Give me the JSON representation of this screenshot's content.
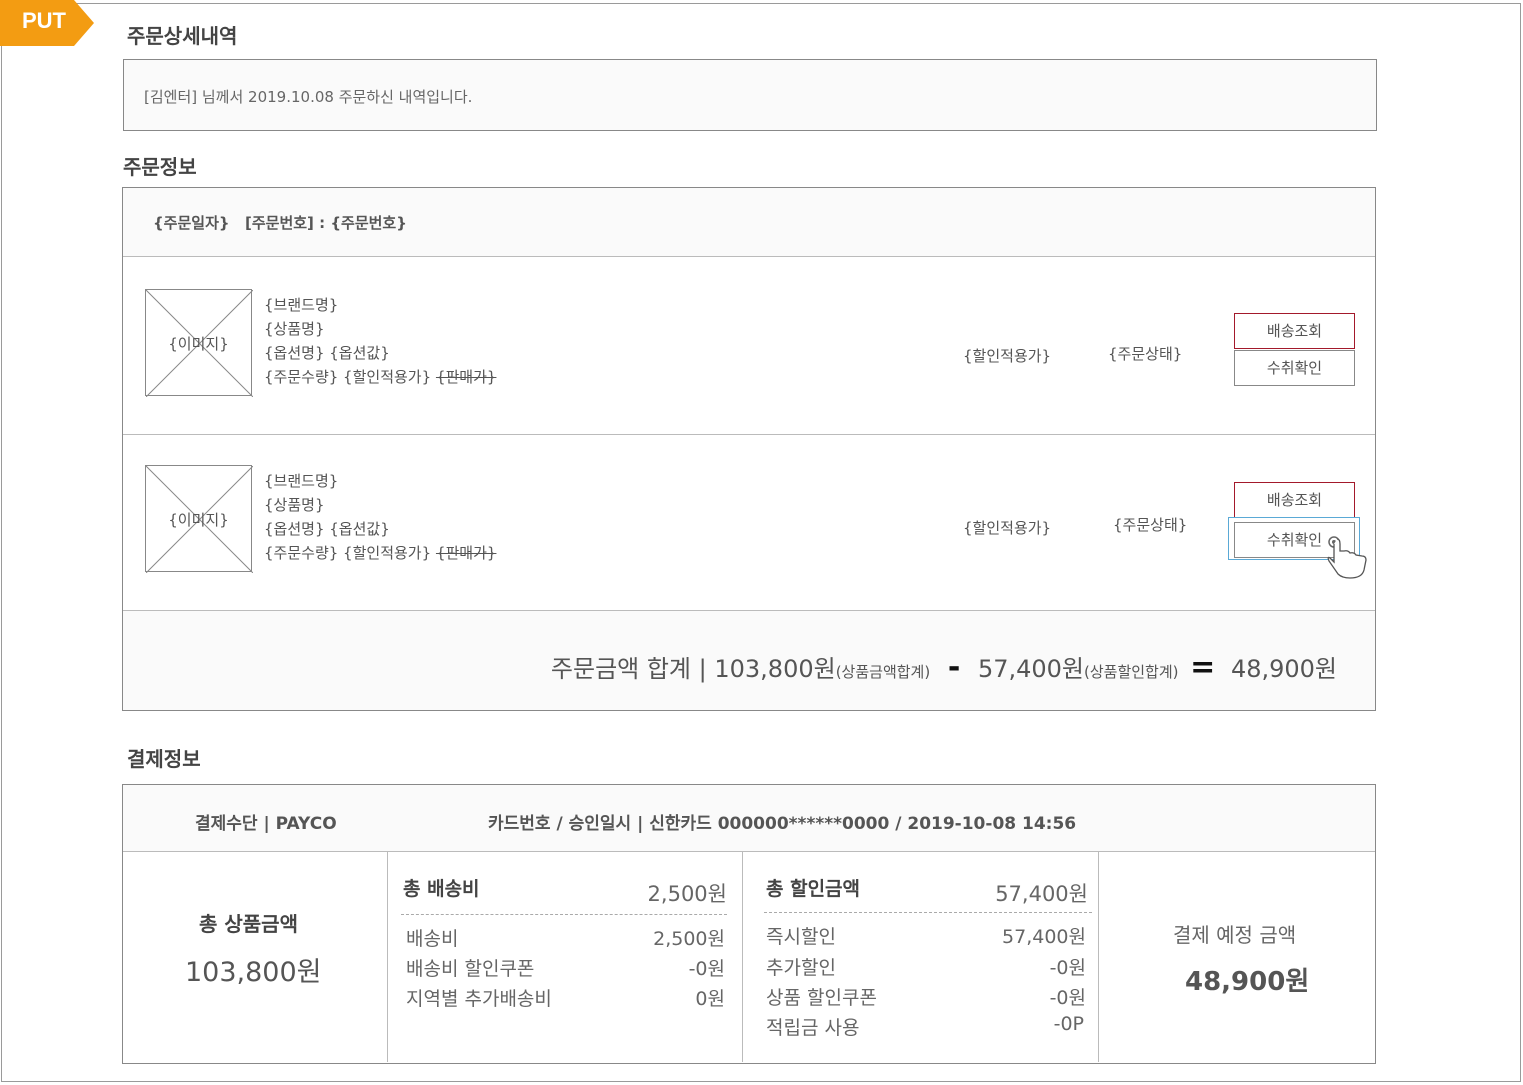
{
  "tag": {
    "label": "PUT",
    "color": "#f39c12"
  },
  "order_detail": {
    "title": "주문상세내역",
    "greeting": "[김엔터] 님께서 2019.10.08 주문하신 내역입니다."
  },
  "order_info": {
    "title": "주문정보",
    "header": {
      "date": "{주문일자}",
      "number_label": "[주문번호] : {주문번호}"
    },
    "items": [
      {
        "image_label": "{이미지}",
        "brand": "{브랜드명}",
        "product": "{상품명}",
        "option": "{옵션명} {옵션값}",
        "qty_price": "{주문수량} {할인적용가}",
        "list_price": "{판매가}",
        "discount_price": "{할인적용가}",
        "status": "{주문상태}",
        "track_button": "배송조회",
        "confirm_button": "수취확인"
      },
      {
        "image_label": "{이미지}",
        "brand": "{브랜드명}",
        "product": "{상품명}",
        "option": "{옵션명} {옵션값}",
        "qty_price": "{주문수량} {할인적용가}",
        "list_price": "{판매가}",
        "discount_price": "{할인적용가}",
        "status": "{주문상태}",
        "track_button": "배송조회",
        "confirm_button": "수취확인"
      }
    ],
    "summary": {
      "label": "주문금액 합계 | 103,800원",
      "goods_note": "(상품금액합계)",
      "minus": "-",
      "discount": "57,400원",
      "discount_note": "(상품할인합계)",
      "equals": "=",
      "total": "48,900원"
    }
  },
  "payment_info": {
    "title": "결제정보",
    "method": "결제수단 | PAYCO",
    "card": "카드번호 / 승인일시 |  신한카드 000000******0000 / 2019-10-08 14:56",
    "goods_total": {
      "label": "총 상품금액",
      "value": "103,800원"
    },
    "shipping": {
      "label": "총 배송비",
      "value": "2,500원",
      "rows": [
        {
          "label": "배송비",
          "value": "2,500원"
        },
        {
          "label": "배송비 할인쿠폰",
          "value": "-0원"
        },
        {
          "label": "지역별 추가배송비",
          "value": "0원"
        }
      ]
    },
    "discount": {
      "label": "총 할인금액",
      "value": "57,400원",
      "rows": [
        {
          "label": "즉시할인",
          "value": "57,400원"
        },
        {
          "label": "추가할인",
          "value": "-0원"
        },
        {
          "label": "상품 할인쿠폰",
          "value": "-0원"
        },
        {
          "label": "적립금 사용",
          "value": "-0P"
        }
      ]
    },
    "expected": {
      "label": "결제 예정 금액",
      "value": "48,900원"
    }
  },
  "colors": {
    "accent": "#f39c12",
    "button_red": "#a3192b",
    "highlight_blue": "#5aa9d6"
  }
}
